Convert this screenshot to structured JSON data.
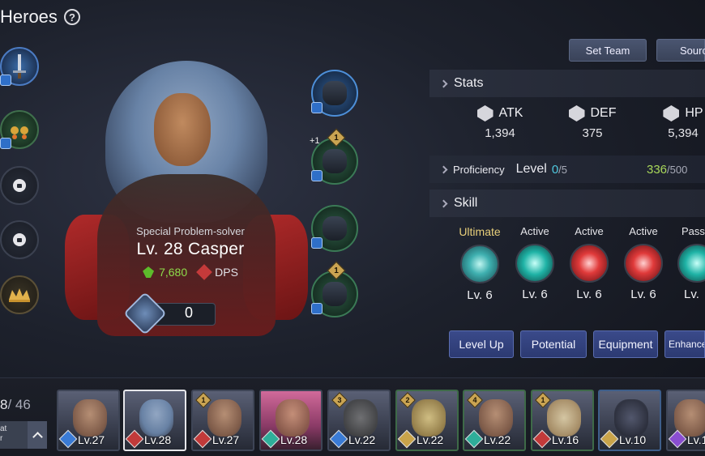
{
  "header": {
    "title": "Heroes",
    "help_symbol": "?"
  },
  "left_slots": [
    {
      "name": "weapon-slot",
      "icon": "sword-icon",
      "style": "weapon"
    },
    {
      "name": "accessory-slot",
      "icon": "earring-icon",
      "style": "green"
    },
    {
      "name": "locked-slot-1",
      "icon": "lock-icon",
      "style": "locked"
    },
    {
      "name": "locked-slot-2",
      "icon": "lock-icon",
      "style": "locked"
    },
    {
      "name": "crown-slot",
      "icon": "crown-icon",
      "style": "gold"
    }
  ],
  "hero": {
    "subtitle": "Special Problem-solver",
    "level_name": "Lv. 28  Casper",
    "power": "7,680",
    "role": "DPS",
    "shards": "0"
  },
  "gear": [
    {
      "icon": "hood-icon",
      "style": "blue",
      "tier": ""
    },
    {
      "icon": "armor-icon",
      "style": "green",
      "tier": "1",
      "prefix": "+1"
    },
    {
      "icon": "glove-icon",
      "style": "green",
      "tier": ""
    },
    {
      "icon": "boots-icon",
      "style": "green",
      "tier": "1"
    }
  ],
  "top_buttons": {
    "set_team": "Set Team",
    "source": "Sourc"
  },
  "stats": {
    "title": "Stats",
    "items": [
      {
        "label": "ATK",
        "value": "1,394"
      },
      {
        "label": "DEF",
        "value": "375"
      },
      {
        "label": "HP",
        "value": "5,394"
      }
    ]
  },
  "proficiency": {
    "label": "Proficiency",
    "level_label": "Level",
    "current": "0",
    "max": "/5",
    "xp": "336",
    "xp_max": "/500"
  },
  "skill": {
    "title": "Skill",
    "items": [
      {
        "type": "Ultimate",
        "level": "Lv. 6",
        "style": "teal"
      },
      {
        "type": "Active",
        "level": "Lv. 6",
        "style": "cyan"
      },
      {
        "type": "Active",
        "level": "Lv. 6",
        "style": "red"
      },
      {
        "type": "Active",
        "level": "Lv. 6",
        "style": "red"
      },
      {
        "type": "Passi",
        "level": "Lv. ",
        "style": "cyan"
      }
    ]
  },
  "actions": {
    "level_up": "Level Up",
    "potential": "Potential",
    "equipment": "Equipment",
    "enhance": "Enhance"
  },
  "roster": {
    "count_current": "8",
    "count_total": "/ 46",
    "filter_label_1": "at",
    "filter_label_2": "r",
    "cards": [
      {
        "level": "Lv.27",
        "type": "blue",
        "star": ""
      },
      {
        "level": "Lv.28",
        "type": "red",
        "star": "",
        "selected": true
      },
      {
        "level": "Lv.27",
        "type": "red",
        "star": "1"
      },
      {
        "level": "Lv.28",
        "type": "teal",
        "star": ""
      },
      {
        "level": "Lv.22",
        "type": "blue",
        "star": "3"
      },
      {
        "level": "Lv.22",
        "type": "gold",
        "star": "2"
      },
      {
        "level": "Lv.22",
        "type": "teal",
        "star": "4"
      },
      {
        "level": "Lv.16",
        "type": "red",
        "star": "1"
      },
      {
        "level": "Lv.10",
        "type": "gold",
        "star": ""
      },
      {
        "level": "Lv.1",
        "type": "purple",
        "star": ""
      }
    ]
  }
}
